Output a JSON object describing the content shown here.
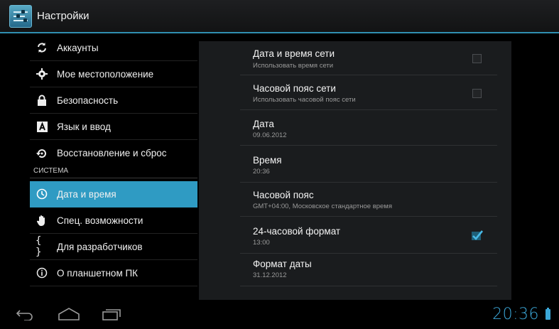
{
  "actionbar": {
    "title": "Настройки"
  },
  "left": {
    "items": [
      {
        "label": "Аккаунты",
        "icon": "sync-icon"
      },
      {
        "label": "Мое местоположение",
        "icon": "location-icon"
      },
      {
        "label": "Безопасность",
        "icon": "lock-icon"
      },
      {
        "label": "Язык и ввод",
        "icon": "keyboard-a-icon"
      },
      {
        "label": "Восстановление и сброс",
        "icon": "restore-icon"
      }
    ],
    "section_header": "СИСТЕМА",
    "system_items": [
      {
        "label": "Дата и время",
        "icon": "clock-icon",
        "selected": true
      },
      {
        "label": "Спец. возможности",
        "icon": "hand-icon"
      },
      {
        "label": "Для разработчиков",
        "icon": "braces-icon"
      },
      {
        "label": "О планшетном ПК",
        "icon": "info-icon"
      }
    ]
  },
  "right": {
    "items": [
      {
        "title": "Дата и время сети",
        "summary": "Использовать время сети",
        "control": "checkbox",
        "checked": false
      },
      {
        "title": "Часовой пояс сети",
        "summary": "Использовать часовой пояс сети",
        "control": "checkbox",
        "checked": false
      },
      {
        "title": "Дата",
        "summary": "09.06.2012"
      },
      {
        "title": "Время",
        "summary": "20:36"
      },
      {
        "title": "Часовой пояс",
        "summary": "GMT+04:00, Московское стандартное время"
      },
      {
        "title": "24-часовой формат",
        "summary": "13:00",
        "control": "checkbox",
        "checked": true
      },
      {
        "title": "Формат даты",
        "summary": "31.12.2012"
      }
    ]
  },
  "statusbar": {
    "clock": "20:36"
  },
  "colors": {
    "accent": "#2f9bc3",
    "clock": "#3ba7d8"
  }
}
